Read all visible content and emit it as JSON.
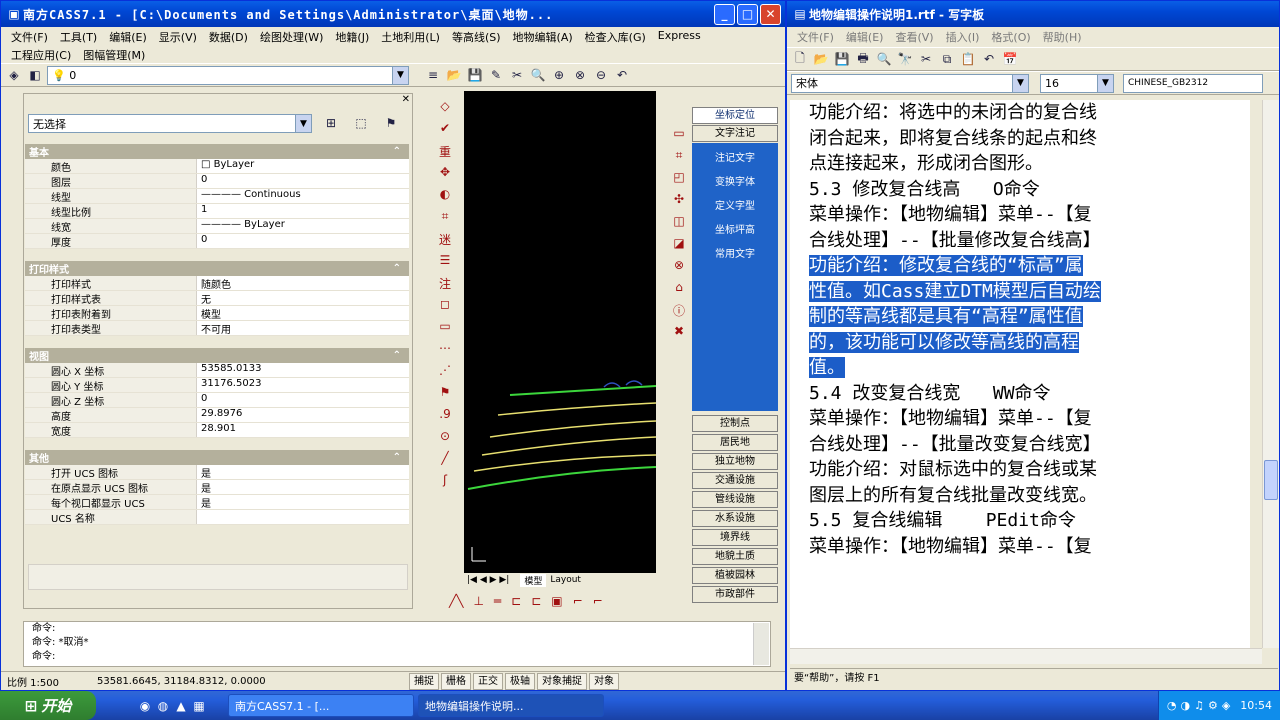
{
  "left_window": {
    "title": "南方CASS7.1 - [C:\\Documents and Settings\\Administrator\\桌面\\地物...",
    "menu_row1": [
      "文件(F)",
      "工具(T)",
      "编辑(E)",
      "显示(V)",
      "数据(D)",
      "绘图处理(W)",
      "地籍(J)",
      "土地利用(L)",
      "等高线(S)"
    ],
    "menu_row2": [
      "地物编辑(A)",
      "检查入库(G)",
      "Express",
      "工程应用(C)",
      "图幅管理(M)"
    ],
    "layer_combo": "0",
    "select_combo": "无选择",
    "sections": {
      "basic": {
        "title": "基本",
        "rows": [
          {
            "k": "颜色",
            "v": "□ ByLayer"
          },
          {
            "k": "图层",
            "v": "0"
          },
          {
            "k": "线型",
            "v": "———— Continuous"
          },
          {
            "k": "线型比例",
            "v": "1"
          },
          {
            "k": "线宽",
            "v": "———— ByLayer"
          },
          {
            "k": "厚度",
            "v": "0"
          }
        ]
      },
      "print": {
        "title": "打印样式",
        "rows": [
          {
            "k": "打印样式",
            "v": "随颜色"
          },
          {
            "k": "打印样式表",
            "v": "无"
          },
          {
            "k": "打印表附着到",
            "v": "模型"
          },
          {
            "k": "打印表类型",
            "v": "不可用"
          }
        ]
      },
      "view": {
        "title": "视图",
        "rows": [
          {
            "k": "圆心 X 坐标",
            "v": "53585.0133"
          },
          {
            "k": "圆心 Y 坐标",
            "v": "31176.5023"
          },
          {
            "k": "圆心 Z 坐标",
            "v": "0"
          },
          {
            "k": "高度",
            "v": "29.8976"
          },
          {
            "k": "宽度",
            "v": "28.901"
          }
        ]
      },
      "other": {
        "title": "其他",
        "rows": [
          {
            "k": "打开 UCS 图标",
            "v": "是"
          },
          {
            "k": "在原点显示 UCS 图标",
            "v": "是"
          },
          {
            "k": "每个视口都显示 UCS",
            "v": "是"
          },
          {
            "k": "UCS 名称",
            "v": ""
          }
        ]
      }
    },
    "blue_panel_top": [
      "坐标定位",
      "文字注记"
    ],
    "blue_panel_items": [
      "注记文字",
      "变换字体",
      "定义字型",
      "坐标坪高",
      "常用文字"
    ],
    "side_buttons": [
      "控制点",
      "居民地",
      "独立地物",
      "交通设施",
      "管线设施",
      "水系设施",
      "境界线",
      "地貌土质",
      "植被园林",
      "市政部件"
    ],
    "layout_tabs": [
      "模型",
      "Layout"
    ],
    "command_lines": [
      "命令:",
      "命令: *取消*",
      "命令:"
    ],
    "status": {
      "scale": "比例 1:500",
      "coords": "53581.6645, 31184.8312, 0.0000",
      "toggles": [
        "捕捉",
        "栅格",
        "正交",
        "极轴",
        "对象捕捉",
        "对象"
      ]
    }
  },
  "right_window": {
    "title": "地物编辑操作说明1.rtf - 写字板",
    "menu": [
      "文件(F)",
      "编辑(E)",
      "查看(V)",
      "插入(I)",
      "格式(O)",
      "帮助(H)"
    ],
    "font_name": "宋体",
    "font_size": "16",
    "charset": "CHINESE_GB2312",
    "lines": [
      "功能介绍：将选中的未闭合的复合线",
      "闭合起来，即将复合线条的起点和终",
      "点连接起来，形成闭合图形。",
      "",
      "5.3 修改复合线高   O命令",
      "",
      "菜单操作：【地物编辑】菜单--【复",
      "合线处理】--【批量修改复合线高】",
      "功能介绍：修改复合线的“标高”属",
      "性值。如Cass建立DTM模型后自动绘",
      "制的等高线都是具有“高程”属性值",
      "的，该功能可以修改等高线的高程",
      "值。",
      "",
      "5.4 改变复合线宽   WW命令",
      "菜单操作：【地物编辑】菜单--【复",
      "合线处理】--【批量改变复合线宽】",
      "功能介绍：对鼠标选中的复合线或某",
      "图层上的所有复合线批量改变线宽。",
      "",
      "5.5 复合线编辑    PEdit命令",
      "菜单操作：【地物编辑】菜单--【复"
    ],
    "status": "要“帮助”，请按 F1"
  },
  "taskbar": {
    "start": "开始",
    "tasks": [
      "南方CASS7.1 - [...",
      "地物编辑操作说明..."
    ],
    "clock": "10:54"
  },
  "colors": {
    "accent": "#1f63c8",
    "selection": "#1c5dc8",
    "contour_green": "#3cd63c",
    "contour_yellow": "#e8e070"
  }
}
